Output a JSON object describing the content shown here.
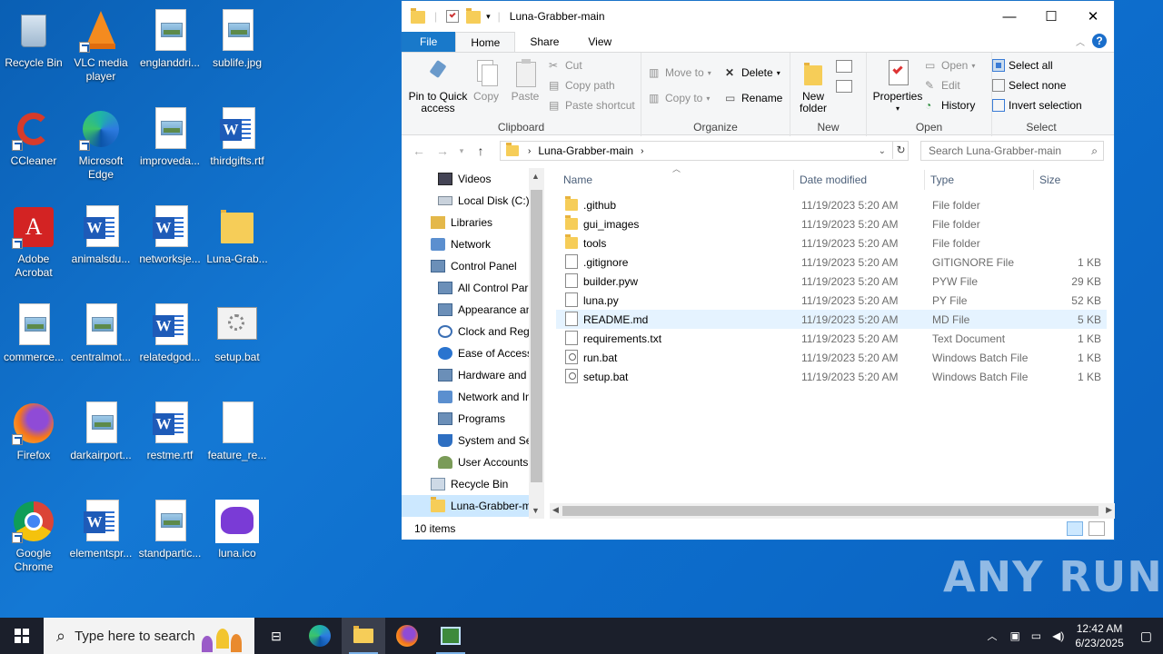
{
  "desktop": {
    "icons": [
      {
        "label": "Recycle Bin",
        "icon": "recycle-bin-icon"
      },
      {
        "label": "VLC media player",
        "icon": "vlc-icon"
      },
      {
        "label": "englanddri...",
        "icon": "image-file-icon"
      },
      {
        "label": "sublife.jpg",
        "icon": "image-file-icon"
      },
      {
        "label": "CCleaner",
        "icon": "ccleaner-icon"
      },
      {
        "label": "Microsoft Edge",
        "icon": "edge-icon"
      },
      {
        "label": "improveda...",
        "icon": "image-file-icon"
      },
      {
        "label": "thirdgifts.rtf",
        "icon": "word-doc-icon"
      },
      {
        "label": "Adobe Acrobat",
        "icon": "acrobat-icon"
      },
      {
        "label": "animalsdu...",
        "icon": "word-doc-icon"
      },
      {
        "label": "networksje...",
        "icon": "word-doc-icon"
      },
      {
        "label": "Luna-Grab...",
        "icon": "folder-icon"
      },
      {
        "label": "commerce...",
        "icon": "image-file-icon"
      },
      {
        "label": "centralmot...",
        "icon": "image-file-icon"
      },
      {
        "label": "relatedgod...",
        "icon": "word-doc-icon"
      },
      {
        "label": "setup.bat",
        "icon": "batch-file-icon"
      },
      {
        "label": "Firefox",
        "icon": "firefox-icon"
      },
      {
        "label": "darkairport...",
        "icon": "image-file-icon"
      },
      {
        "label": "restme.rtf",
        "icon": "word-doc-icon"
      },
      {
        "label": "feature_re...",
        "icon": "blank-file-icon"
      },
      {
        "label": "Google Chrome",
        "icon": "chrome-icon"
      },
      {
        "label": "elementspr...",
        "icon": "word-doc-icon"
      },
      {
        "label": "standpartic...",
        "icon": "image-file-icon"
      },
      {
        "label": "luna.ico",
        "icon": "discord-icon"
      }
    ]
  },
  "explorer": {
    "title": "Luna-Grabber-main",
    "tabs": {
      "file": "File",
      "home": "Home",
      "share": "Share",
      "view": "View"
    },
    "help": "?",
    "ribbon": {
      "pin": "Pin to Quick access",
      "copy": "Copy",
      "paste": "Paste",
      "cut": "Cut",
      "copy_path": "Copy path",
      "paste_shortcut": "Paste shortcut",
      "clipboard": "Clipboard",
      "move_to": "Move to",
      "copy_to": "Copy to",
      "delete": "Delete",
      "rename": "Rename",
      "organize": "Organize",
      "new_folder": "New folder",
      "new": "New",
      "properties": "Properties",
      "open": "Open",
      "edit": "Edit",
      "history": "History",
      "open_group": "Open",
      "select_all": "Select all",
      "select_none": "Select none",
      "invert_selection": "Invert selection",
      "select": "Select"
    },
    "address": {
      "crumb": "Luna-Grabber-main",
      "search_placeholder": "Search Luna-Grabber-main"
    },
    "nav": [
      {
        "label": "Videos",
        "indent": 40,
        "icon": "videos-icon"
      },
      {
        "label": "Local Disk (C:)",
        "indent": 40,
        "icon": "drive-icon"
      },
      {
        "label": "Libraries",
        "indent": 32,
        "icon": "libraries-icon"
      },
      {
        "label": "Network",
        "indent": 32,
        "icon": "network-icon"
      },
      {
        "label": "Control Panel",
        "indent": 32,
        "icon": "control-panel-icon"
      },
      {
        "label": "All Control Par",
        "indent": 40,
        "icon": "control-panel-icon"
      },
      {
        "label": "Appearance an",
        "indent": 40,
        "icon": "appearance-icon"
      },
      {
        "label": "Clock and Regi",
        "indent": 40,
        "icon": "clock-icon"
      },
      {
        "label": "Ease of Access",
        "indent": 40,
        "icon": "ease-icon"
      },
      {
        "label": "Hardware and",
        "indent": 40,
        "icon": "hardware-icon"
      },
      {
        "label": "Network and In",
        "indent": 40,
        "icon": "network-icon"
      },
      {
        "label": "Programs",
        "indent": 40,
        "icon": "programs-icon"
      },
      {
        "label": "System and Sec",
        "indent": 40,
        "icon": "shield-icon"
      },
      {
        "label": "User Accounts",
        "indent": 40,
        "icon": "users-icon"
      },
      {
        "label": "Recycle Bin",
        "indent": 32,
        "icon": "recycle-bin-icon"
      },
      {
        "label": "Luna-Grabber-m",
        "indent": 32,
        "icon": "folder-icon",
        "selected": true
      }
    ],
    "columns": {
      "name": "Name",
      "date": "Date modified",
      "type": "Type",
      "size": "Size"
    },
    "files": [
      {
        "name": ".github",
        "date": "11/19/2023 5:20 AM",
        "type": "File folder",
        "size": "",
        "kind": "folder"
      },
      {
        "name": "gui_images",
        "date": "11/19/2023 5:20 AM",
        "type": "File folder",
        "size": "",
        "kind": "folder"
      },
      {
        "name": "tools",
        "date": "11/19/2023 5:20 AM",
        "type": "File folder",
        "size": "",
        "kind": "folder"
      },
      {
        "name": ".gitignore",
        "date": "11/19/2023 5:20 AM",
        "type": "GITIGNORE File",
        "size": "1 KB",
        "kind": "file"
      },
      {
        "name": "builder.pyw",
        "date": "11/19/2023 5:20 AM",
        "type": "PYW File",
        "size": "29 KB",
        "kind": "file"
      },
      {
        "name": "luna.py",
        "date": "11/19/2023 5:20 AM",
        "type": "PY File",
        "size": "52 KB",
        "kind": "file"
      },
      {
        "name": "README.md",
        "date": "11/19/2023 5:20 AM",
        "type": "MD File",
        "size": "5 KB",
        "kind": "file",
        "hover": true
      },
      {
        "name": "requirements.txt",
        "date": "11/19/2023 5:20 AM",
        "type": "Text Document",
        "size": "1 KB",
        "kind": "file"
      },
      {
        "name": "run.bat",
        "date": "11/19/2023 5:20 AM",
        "type": "Windows Batch File",
        "size": "1 KB",
        "kind": "bat"
      },
      {
        "name": "setup.bat",
        "date": "11/19/2023 5:20 AM",
        "type": "Windows Batch File",
        "size": "1 KB",
        "kind": "bat"
      }
    ],
    "status": "10 items"
  },
  "taskbar": {
    "search_placeholder": "Type here to search",
    "time": "12:42 AM",
    "date": "6/23/2025"
  },
  "watermark": "ANY RUN"
}
